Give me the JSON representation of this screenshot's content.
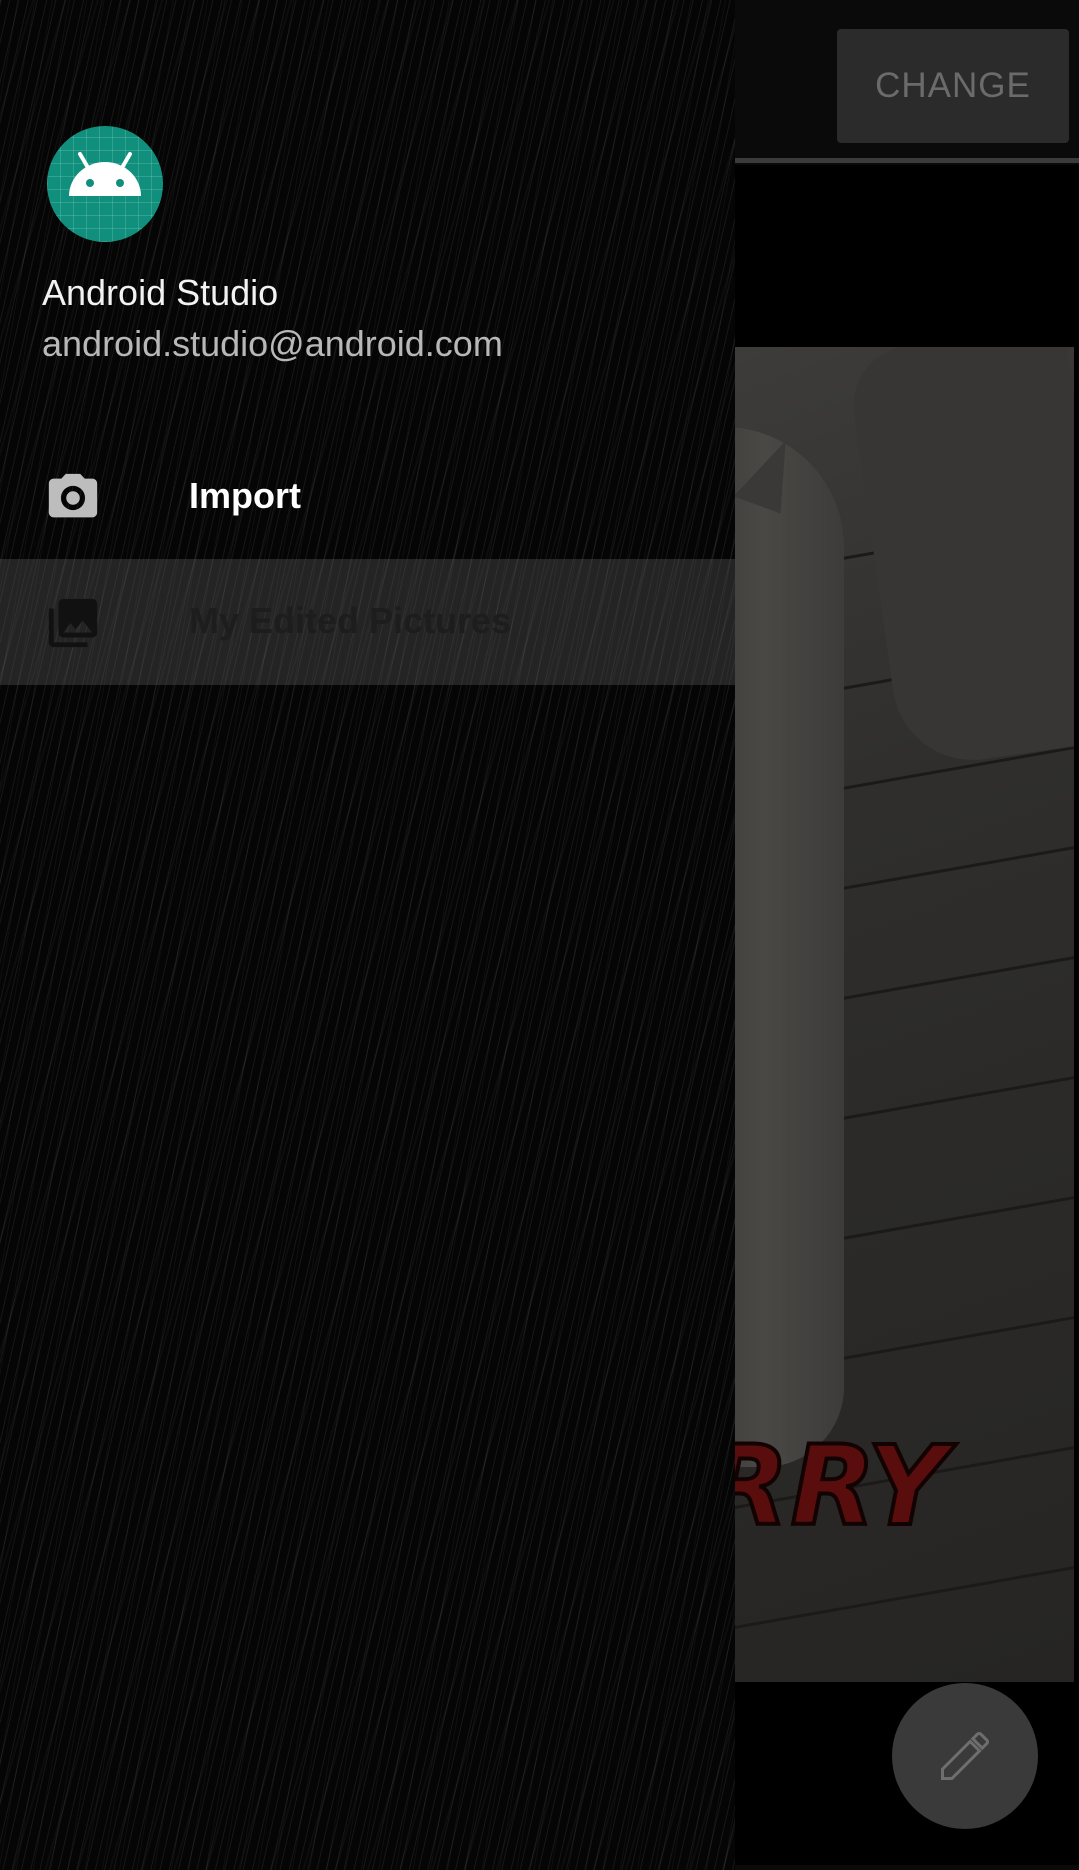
{
  "app": {
    "change_button_label": "CHANGE",
    "photo_caption": "RRY",
    "fab_icon": "pencil-icon"
  },
  "drawer": {
    "avatar_icon": "android-icon",
    "user_name": "Android Studio",
    "user_email": "android.studio@android.com",
    "items": [
      {
        "label": "Import",
        "icon": "camera-icon",
        "selected": false
      },
      {
        "label": "My Edited Pictures",
        "icon": "photo-library-icon",
        "selected": true
      }
    ]
  },
  "colors": {
    "avatar_bg": "#0f8f7c",
    "drawer_bg": "#050505",
    "selected_item_bg": "#3a3a3a"
  }
}
